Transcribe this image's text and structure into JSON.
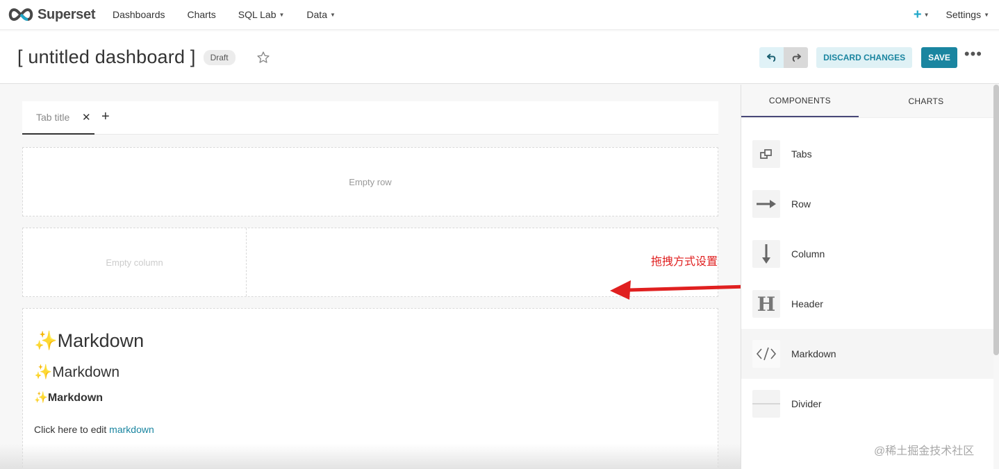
{
  "nav": {
    "brand": "Superset",
    "items": [
      "Dashboards",
      "Charts",
      "SQL Lab",
      "Data"
    ],
    "settings": "Settings"
  },
  "header": {
    "title": "[ untitled dashboard ]",
    "badge": "Draft",
    "discard": "DISCARD CHANGES",
    "save": "SAVE"
  },
  "canvas": {
    "tab_title": "Tab title",
    "empty_row": "Empty row",
    "empty_column": "Empty column",
    "markdown": {
      "h1": "✨Markdown",
      "h2": "✨Markdown",
      "h3": "✨Markdown",
      "para_text": "Click here to edit ",
      "para_link": "markdown"
    }
  },
  "annotation": "拖拽方式设置",
  "side": {
    "tabs": [
      "COMPONENTS",
      "CHARTS"
    ],
    "components": [
      {
        "label": "Tabs",
        "icon": "tabs-icon"
      },
      {
        "label": "Row",
        "icon": "row-arrow-icon"
      },
      {
        "label": "Column",
        "icon": "column-arrow-icon"
      },
      {
        "label": "Header",
        "icon": "header-icon"
      },
      {
        "label": "Markdown",
        "icon": "code-icon"
      },
      {
        "label": "Divider",
        "icon": "divider-icon"
      }
    ]
  },
  "watermark": "@稀土掘金技术社区",
  "colors": {
    "accent": "#1a85a0",
    "annotation": "#e02020"
  }
}
